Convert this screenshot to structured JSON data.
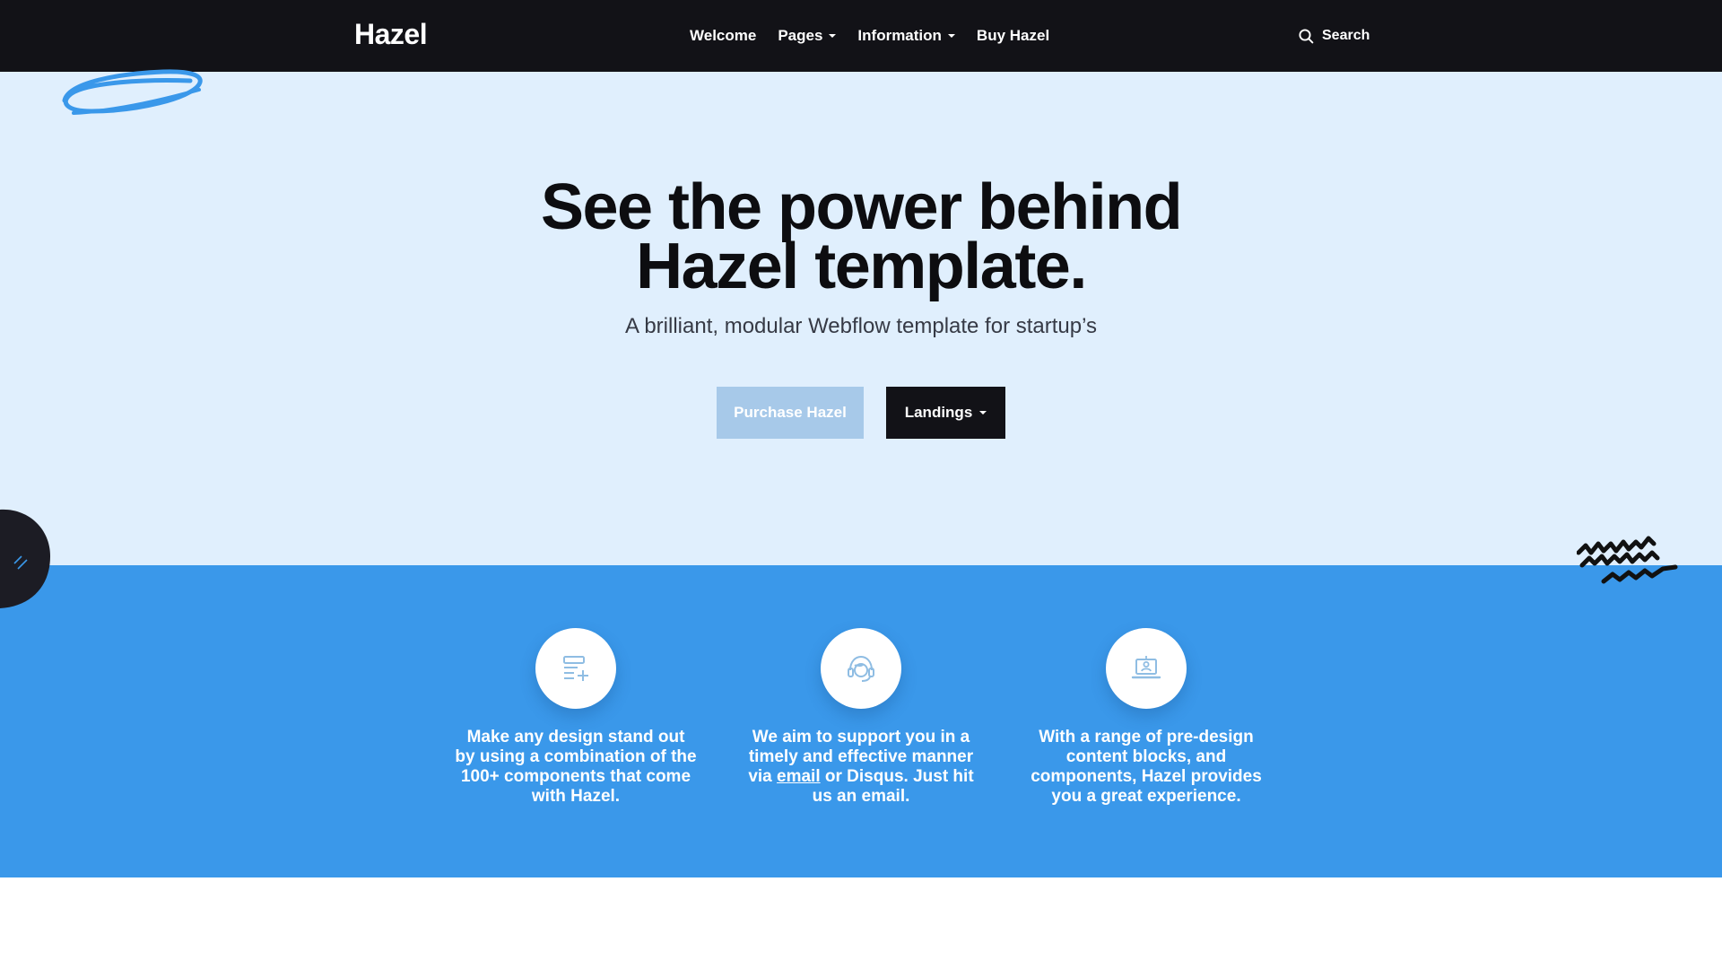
{
  "nav": {
    "logo": "Hazel",
    "links": [
      {
        "label": "Welcome",
        "dropdown": false
      },
      {
        "label": "Pages",
        "dropdown": true
      },
      {
        "label": "Information",
        "dropdown": true
      },
      {
        "label": "Buy Hazel",
        "dropdown": false
      }
    ],
    "search_label": "Search"
  },
  "hero": {
    "title_line1": "See the power behind",
    "title_line2": "Hazel template.",
    "subtitle": "A brilliant, modular Webflow template for startup’s",
    "purchase_label": "Purchase Hazel",
    "landings_label": "Landings"
  },
  "features": [
    {
      "icon": "form-add-icon",
      "text_pre": "Make any design stand out by using a combination of the 100+ components that come with Hazel.",
      "link": "",
      "text_post": ""
    },
    {
      "icon": "support-agent-icon",
      "text_pre": "We aim to support you in a timely and effective manner via ",
      "link": "email",
      "text_post": " or Disqus. Just hit us an email."
    },
    {
      "icon": "laptop-user-icon",
      "text_pre": "With a range of pre-design content blocks, and components, Hazel provides you a great experience.",
      "link": "",
      "text_post": ""
    }
  ],
  "colors": {
    "navbar": "#121217",
    "hero_bg": "#e0effd",
    "features_bg": "#3a98ea",
    "purchase_button": "#a7c9e9",
    "landings_button": "#121217",
    "icon_stroke": "#8fbde3"
  }
}
